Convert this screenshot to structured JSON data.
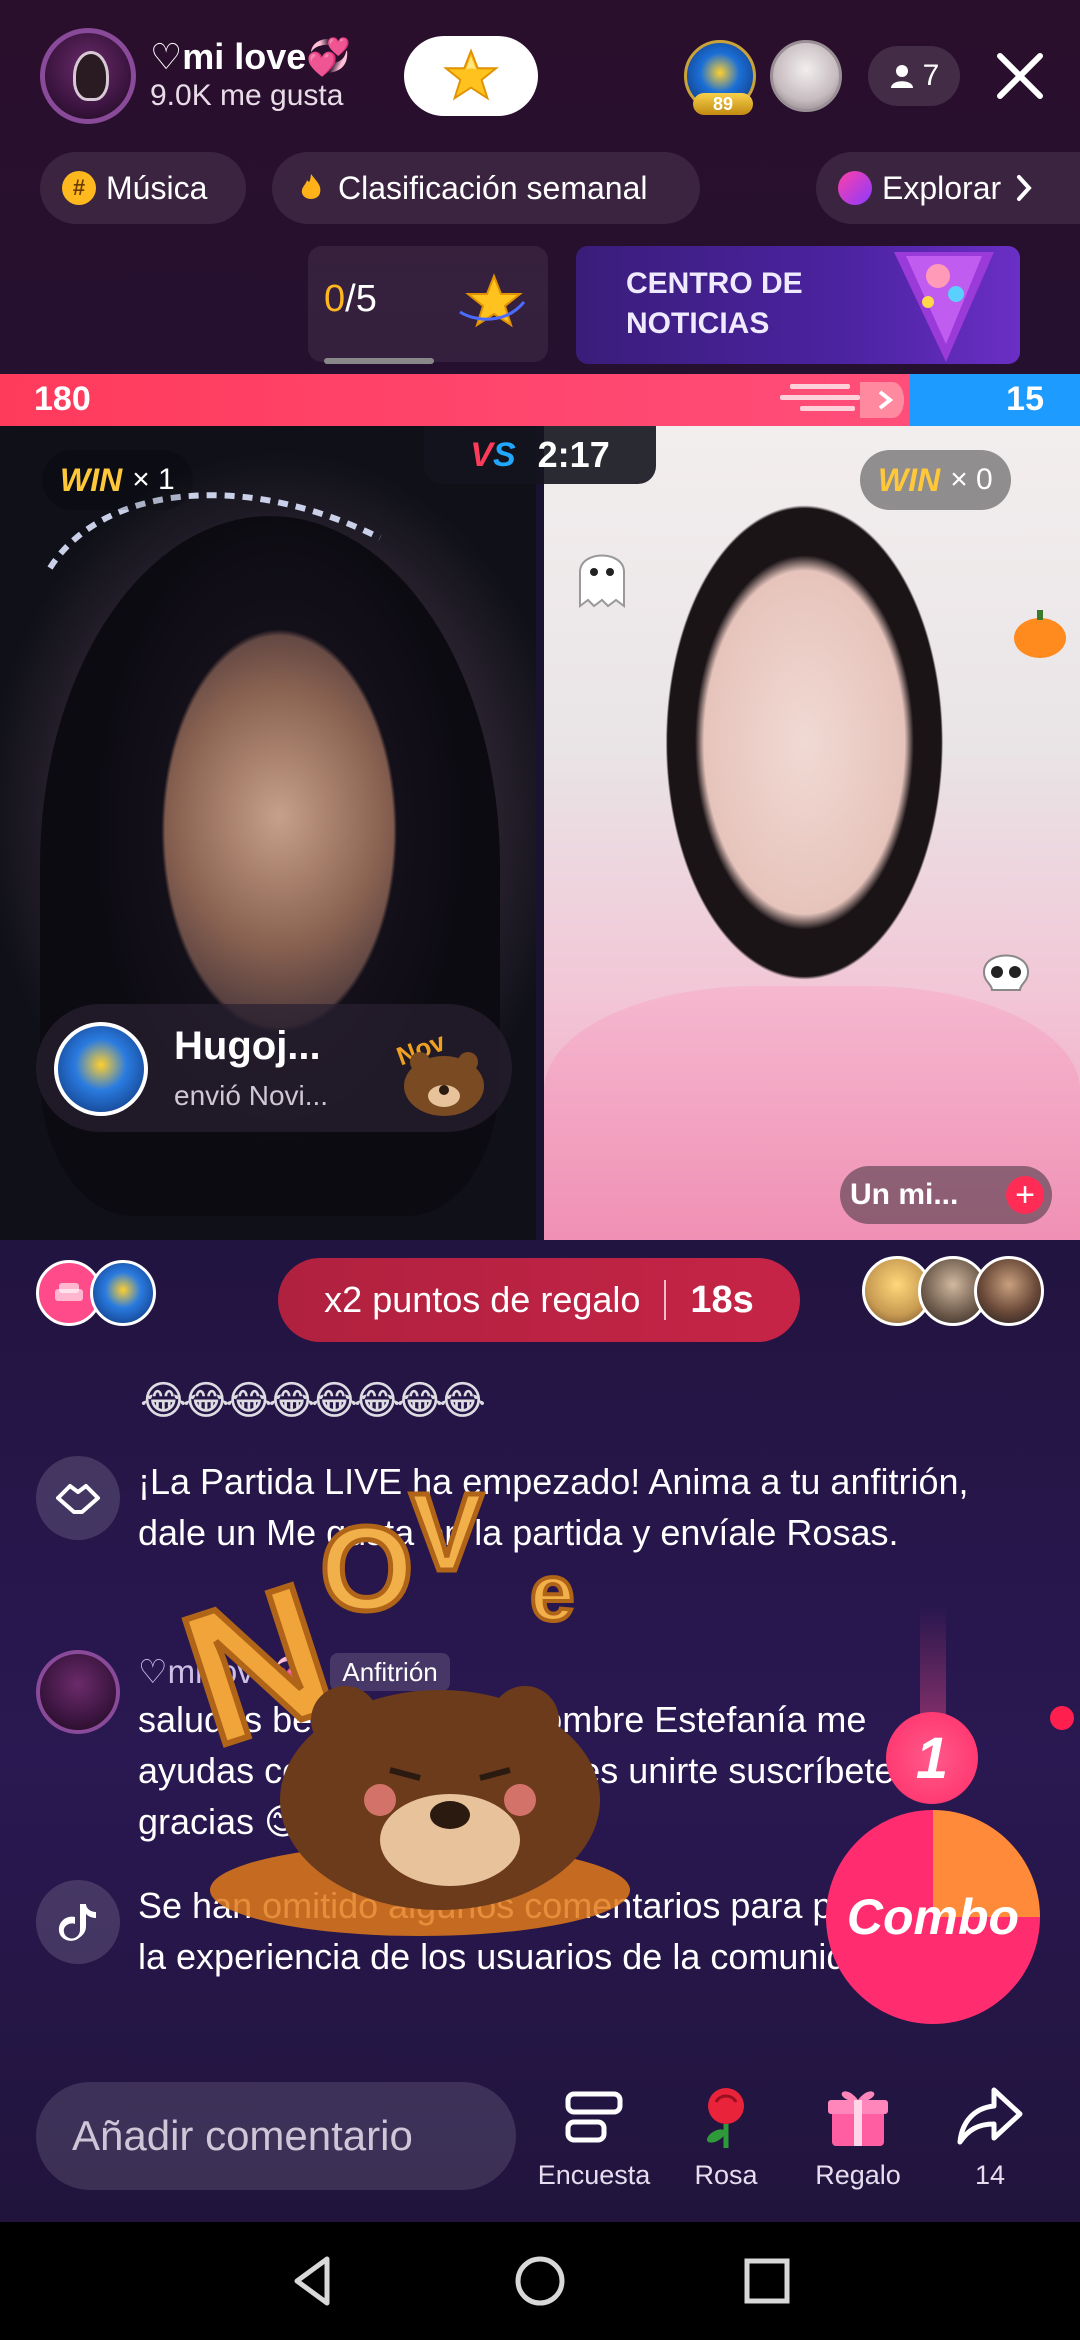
{
  "host": {
    "name": "♡mi love💞",
    "likes": "9.0K me gusta"
  },
  "header": {
    "viewer_count": "7",
    "top_gifter_level": "89"
  },
  "chips": {
    "music": "Música",
    "ranking": "Clasificación semanal",
    "explore": "Explorar"
  },
  "goal": {
    "current": "0",
    "total": "/5"
  },
  "news": {
    "line1": "CENTRO DE",
    "line2": "NOTICIAS"
  },
  "battle": {
    "score_left": "180",
    "score_right": "15",
    "timer": "2:17",
    "vs_v": "V",
    "vs_s": "S",
    "win_label": "WIN",
    "win_left": "× 1",
    "win_right": "× 0",
    "gift_sender": "Hugoj...",
    "gift_text": "envió Novi...",
    "guest_name": "Un mi..."
  },
  "bonus": {
    "label": "x2 puntos de regalo",
    "seconds": "18s"
  },
  "chat": {
    "emoji_row": "😂😂😂😂😂😂😂😂",
    "system_message": "¡La Partida LIVE ha empezado! Anima a tu anfitrión, dale un Me gusta en la partida y envíale Rosas.",
    "host_user": "♡mi love💞",
    "host_role": "Anfitrión",
    "host_message": "saludos bendiciones mi nombre Estefanía me ayudas con tu like y si quieres unirte suscríbete gracias 😊",
    "tiktok_message": "Se han omitido algunos comentarios para proteger la experiencia de los usuarios de la comunidad"
  },
  "combo": {
    "count": "1",
    "label": "Combo"
  },
  "bottom": {
    "comment_placeholder": "Añadir comentario",
    "poll": "Encuesta",
    "rose": "Rosa",
    "gift": "Regalo",
    "share_count": "14"
  },
  "colors": {
    "team_red": "#ff3b5c",
    "team_blue": "#1e9bff",
    "accent_gold": "#ffb620"
  }
}
